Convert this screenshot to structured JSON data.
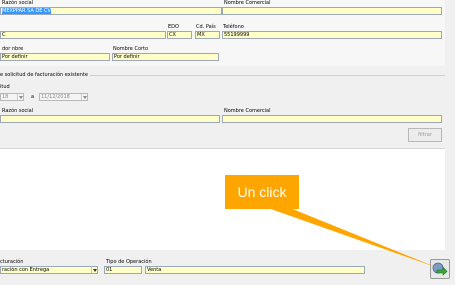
{
  "empresa": {
    "razon_social_label": "Razón social",
    "razon_social_value": "MEXPPAR SA DE CV",
    "nombre_comercial_label": "Nombre Comercial",
    "nombre_comercial_value": "",
    "rfc_value": "C",
    "edo_label": "EDO",
    "edo_value": "CX",
    "pais_label": "Cd. País",
    "pais_value": "MX",
    "telefono_label": "Teléfono",
    "telefono_value": "55199999",
    "contacto_label": "dor nbre",
    "contacto_value": "Por definir",
    "nombre_corto_label": "Nombre Corto",
    "nombre_corto_value": "Por definir"
  },
  "busqueda": {
    "title": "e solicitud de facturación existente",
    "fecha_label": "itud",
    "fecha_desde": "18",
    "a_label": "a",
    "fecha_hasta": "11/12/2018",
    "razon_social_label": "Razón social",
    "nombre_comercial_label": "Nombre Comercial",
    "filtrar_button": "filtrar"
  },
  "callout": {
    "text": "Un click",
    "color": "#ffa500"
  },
  "footer": {
    "facturacion_label": "cturación",
    "facturacion_value": "ración con Entrega",
    "tipo_operacion_label": "Tipo de Operación",
    "tipo_code": "01",
    "tipo_value": "Venta"
  },
  "icons": {
    "next": "green-arrow-next-icon",
    "dropdown": "chevron-down-icon"
  }
}
